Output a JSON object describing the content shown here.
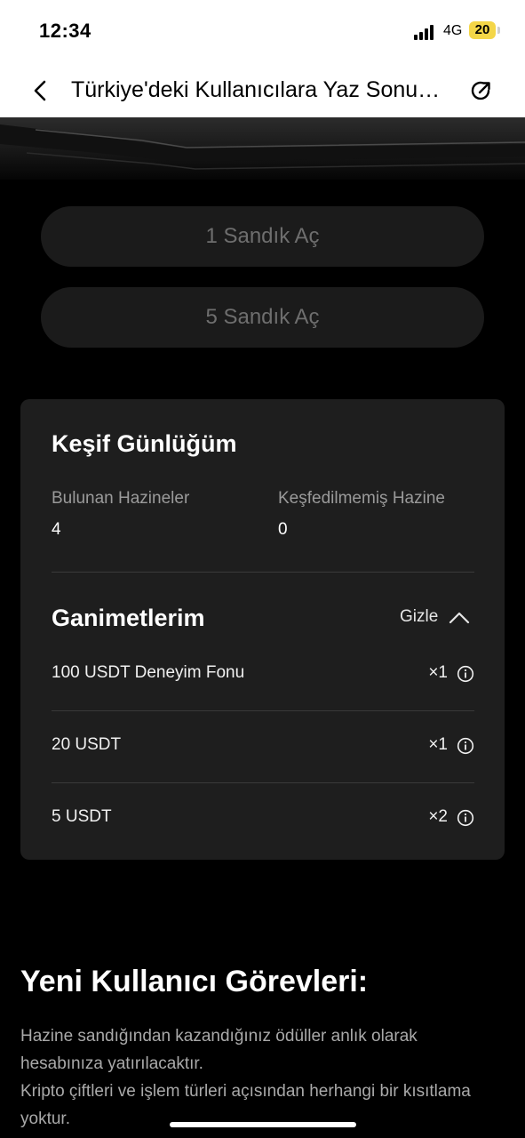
{
  "status_bar": {
    "time": "12:34",
    "network": "4G",
    "battery": "20",
    "battery_color": "#f4d648"
  },
  "nav": {
    "title": "Türkiye'deki Kullanıcılara Yaz Sonu…",
    "back_icon": "chevron-left-icon",
    "share_icon": "share-icon"
  },
  "actions": {
    "open_one": "1 Sandık Aç",
    "open_five": "5 Sandık Aç"
  },
  "journal": {
    "title": "Keşif Günlüğüm",
    "found_label": "Bulunan Hazineler",
    "found_value": "4",
    "undiscovered_label": "Keşfedilmemiş Hazine",
    "undiscovered_value": "0"
  },
  "loot": {
    "title": "Ganimetlerim",
    "toggle_label": "Gizle",
    "items": [
      {
        "name": "100 USDT Deneyim Fonu",
        "qty": "×1"
      },
      {
        "name": "20 USDT",
        "qty": "×1"
      },
      {
        "name": "5 USDT",
        "qty": "×2"
      }
    ]
  },
  "tasks": {
    "title": "Yeni Kullanıcı Görevleri:",
    "line1": "Hazine sandığından kazandığınız ödüller anlık olarak hesabınıza yatırılacaktır.",
    "line2": "Kripto çiftleri ve işlem türleri açısından herhangi bir kısıtlama yoktur."
  }
}
